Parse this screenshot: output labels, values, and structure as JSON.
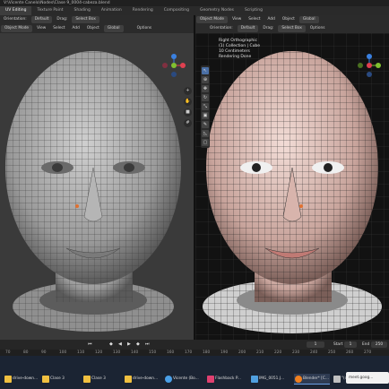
{
  "window": {
    "title": "V:\\Vicente Canelo\\Nodes\\Clase 9_0004-cabeza.blend"
  },
  "workspaces": [
    "UV Editing",
    "Texture Paint",
    "Shading",
    "Animation",
    "Rendering",
    "Compositing",
    "Geometry Nodes",
    "Scripting"
  ],
  "left_viewport": {
    "header": {
      "orientation_label": "Orientation:",
      "orientation_value": "Default",
      "drag_label": "Drag:",
      "drag_value": "Select Box",
      "menus": [
        "Object Mode",
        "View",
        "Select",
        "Add",
        "Object"
      ],
      "transform": "Global",
      "options": "Options"
    }
  },
  "right_viewport": {
    "header": {
      "mode": "Object Mode",
      "menus": [
        "View",
        "Select",
        "Add",
        "Object"
      ],
      "transform": "Global",
      "orientation_label": "Orientation:",
      "orientation_value": "Default",
      "drag_label": "Drag:",
      "drag_value": "Select Box",
      "options": "Options"
    },
    "overlay_info": [
      "Right Orthographic",
      "(1) Collection | Cube",
      "10 Centimeters",
      "Rendering Done"
    ]
  },
  "timeline": {
    "current_frame": "1",
    "start_label": "Start",
    "start_value": "1",
    "end_label": "End",
    "end_value": "250",
    "ticks": [
      "70",
      "80",
      "90",
      "100",
      "110",
      "120",
      "130",
      "140",
      "150",
      "160",
      "170",
      "180",
      "190",
      "200",
      "210",
      "220",
      "230",
      "240",
      "250",
      "260",
      "270"
    ]
  },
  "taskbar": {
    "items": [
      {
        "label": "drive-down...",
        "color": "#f0c040"
      },
      {
        "label": "Clase 3",
        "color": "#f0c040"
      },
      {
        "label": "Clase 3",
        "color": "#f0c040"
      },
      {
        "label": "drive-down...",
        "color": "#f0c040"
      },
      {
        "label": "Vicente (Bo...",
        "color": "#4aa0e8"
      },
      {
        "label": "Flashback P...",
        "color": "#e04070"
      },
      {
        "label": "IMG_0051.J...",
        "color": "#50a0e0"
      },
      {
        "label": "Blender* [C...",
        "color": "#f08020"
      },
      {
        "label": "\"(ddd) (m...",
        "color": "#c0c0c0"
      }
    ],
    "popup": "meet.goog..."
  },
  "colors": {
    "accent": "#4a6fa5",
    "gizmo_x": "#e04050",
    "gizmo_y": "#80c030",
    "gizmo_z": "#3a80e0"
  }
}
